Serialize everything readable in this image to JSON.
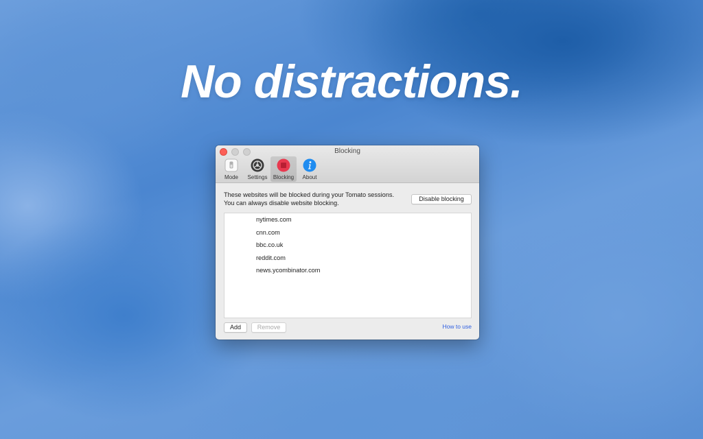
{
  "headline": "No distractions.",
  "window": {
    "title": "Blocking",
    "toolbar": [
      {
        "label": "Mode",
        "icon": "switch-icon"
      },
      {
        "label": "Settings",
        "icon": "gear-icon"
      },
      {
        "label": "Blocking",
        "icon": "stop-icon",
        "selected": true
      },
      {
        "label": "About",
        "icon": "info-icon"
      }
    ],
    "description_line1": "These websites will be blocked during your Tomato sessions.",
    "description_line2": "You can always disable website blocking.",
    "disable_button": "Disable blocking",
    "sites": [
      "nytimes.com",
      "cnn.com",
      "bbc.co.uk",
      "reddit.com",
      "news.ycombinator.com"
    ],
    "add_button": "Add",
    "remove_button": "Remove",
    "how_to_link": "How to use"
  },
  "colors": {
    "close_light": "#fc5f57",
    "stop_icon": "#e8394f",
    "info_icon": "#1f8cf0",
    "link": "#2f5fe0"
  }
}
